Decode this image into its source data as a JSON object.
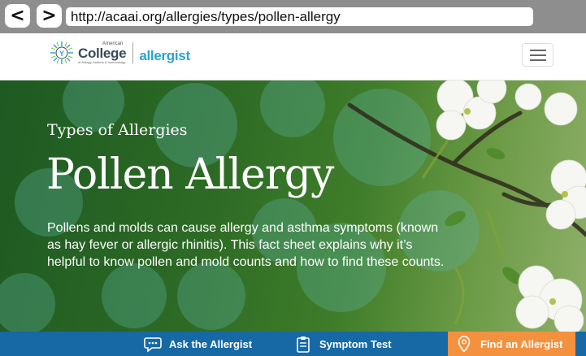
{
  "browser": {
    "back_label": "<",
    "forward_label": ">",
    "url": "http://acaai.org/allergies/types/pollen-allergy"
  },
  "header": {
    "logo_small": "American",
    "logo_college": "College",
    "logo_sub": "of Allergy, Asthma & Immunology",
    "logo_allergist": "allergist"
  },
  "hero": {
    "kicker": "Types of Allergies",
    "title": "Pollen Allergy",
    "description": "Pollens and molds can cause allergy and asthma symptoms (known as hay fever or allergic rhinitis). This fact sheet explains why it’s helpful to know pollen and mold counts and how to find these counts."
  },
  "actions": {
    "ask": "Ask the Allergist",
    "symptom": "Symptom Test",
    "find": "Find an Allergist"
  },
  "colors": {
    "chrome": "#8e8e8e",
    "action_bar": "#1669a5",
    "find_button": "#f3913f",
    "allergist_brand": "#2aa3cf"
  }
}
